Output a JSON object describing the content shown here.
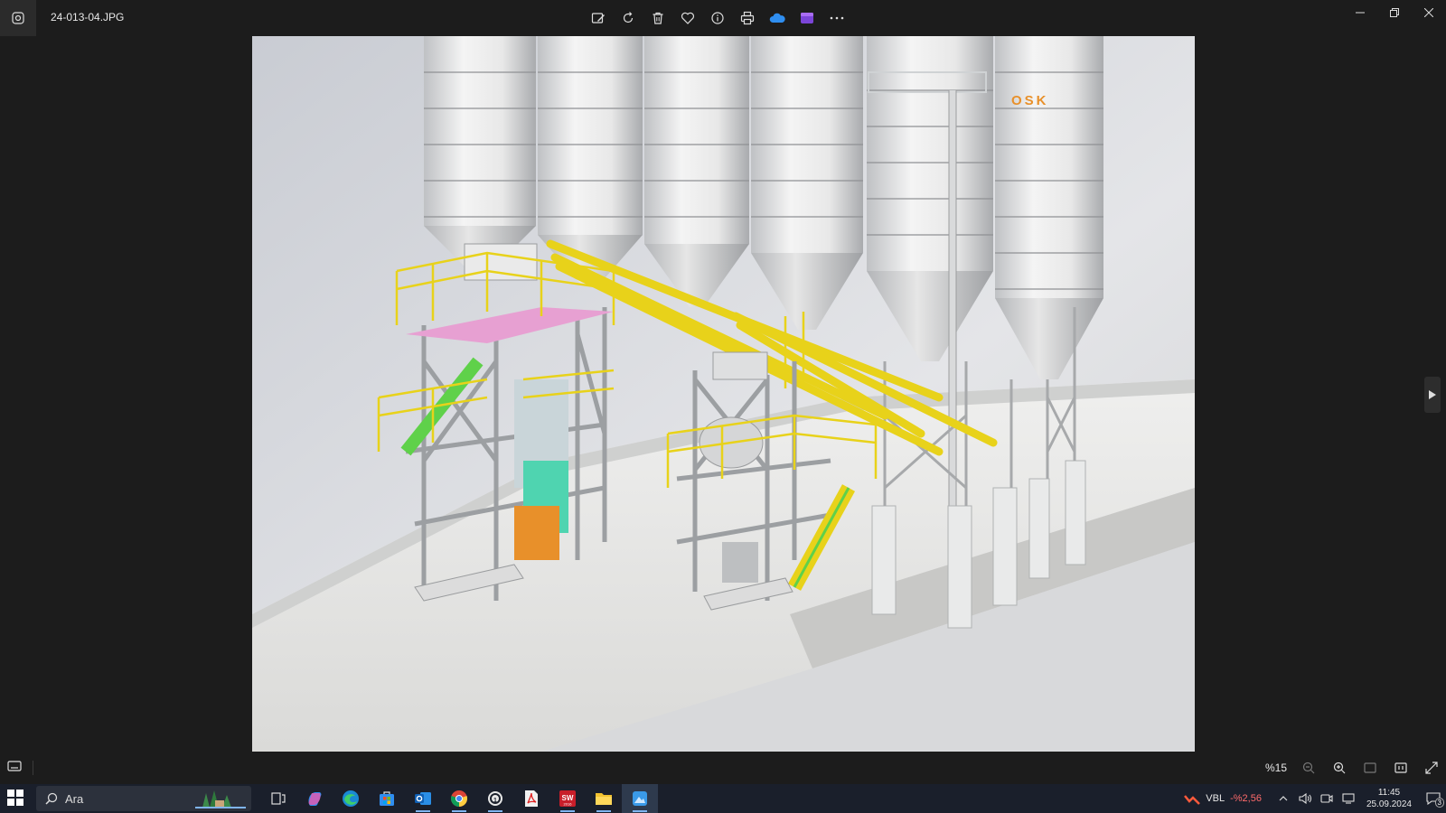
{
  "window": {
    "filename": "24-013-04.JPG"
  },
  "toolbar": {
    "buttons": [
      {
        "name": "edit-image-icon"
      },
      {
        "name": "rotate-icon"
      },
      {
        "name": "delete-icon"
      },
      {
        "name": "favorite-icon"
      },
      {
        "name": "info-icon"
      },
      {
        "name": "print-icon"
      },
      {
        "name": "onedrive-icon"
      },
      {
        "name": "clipchamp-icon"
      },
      {
        "name": "more-options-icon"
      }
    ]
  },
  "image": {
    "description_icon": "3d-render-silo-plant",
    "brand_text": "OSK"
  },
  "statusbar": {
    "zoom": "%15"
  },
  "taskbar": {
    "search_placeholder": "Ara",
    "apps": [
      "task-view",
      "copilot",
      "edge",
      "store",
      "outlook",
      "chrome",
      "whatsapp",
      "acrobat",
      "solidworks",
      "file-explorer",
      "photos"
    ],
    "stock": {
      "symbol": "VBL",
      "change": "-%2,56"
    },
    "clock": {
      "time": "11:45",
      "date": "25.09.2024"
    },
    "notifications": "3"
  },
  "colors": {
    "accent_blue": "#4aa3ff",
    "stock_red": "#ff6b6b",
    "rail_yellow": "#e8d21a",
    "brand_orange": "#e8902a"
  }
}
